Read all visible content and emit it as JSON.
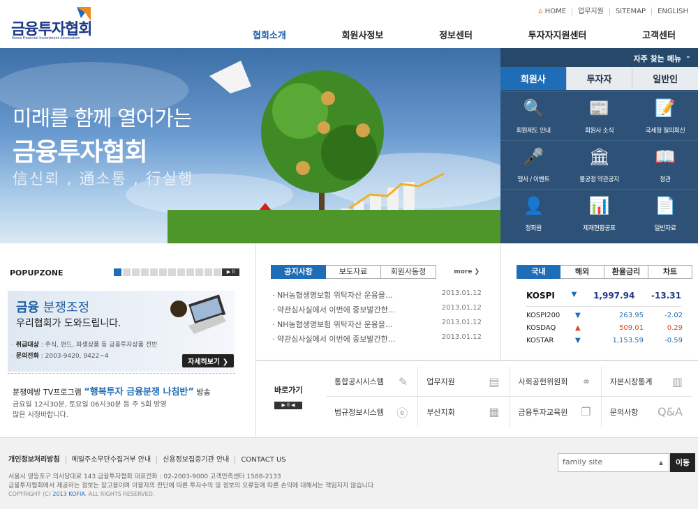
{
  "logo": {
    "title": "금융투자협회",
    "subtitle": "Korea Financial Investment Association"
  },
  "topnav": [
    "HOME",
    "업무지원",
    "SITEMAP",
    "ENGLISH"
  ],
  "gnb": [
    "협회소개",
    "회원사정보",
    "정보센터",
    "투자자지원센터",
    "고객센터"
  ],
  "hero": {
    "line1": "미래를 함께 열어가는",
    "line2": "금융투자협회",
    "line3": "信신뢰 , 通소통 , 行실행"
  },
  "quick": {
    "header": "자주 찾는 메뉴",
    "tabs": [
      "회원사",
      "투자자",
      "일반인"
    ],
    "items": [
      {
        "label": "회원제도 안내",
        "icon": "magnifier-icon"
      },
      {
        "label": "회원사 소식",
        "icon": "newspaper-icon"
      },
      {
        "label": "국세청 질의회신",
        "icon": "document-pencil-icon"
      },
      {
        "label": "행사 / 이벤트",
        "icon": "microphone-icon"
      },
      {
        "label": "불공정 약관공지",
        "icon": "building-icon"
      },
      {
        "label": "정관",
        "icon": "book-icon"
      },
      {
        "label": "정회원",
        "icon": "member-icon"
      },
      {
        "label": "제재현황공표",
        "icon": "chart-magnifier-icon"
      },
      {
        "label": "일반자료",
        "icon": "file-icon"
      }
    ]
  },
  "popup": {
    "title": "POPUPZONE",
    "control": "▶ ll",
    "banner": {
      "title_bold": "금융",
      "title_rest": " 분쟁조정",
      "line2": "우리협회가 도와드립니다.",
      "d1_label": "취급대상",
      "d1": " : 주식, 펀드, 파생상품 등 금융투자상품 전반",
      "d2_label": "문의전화",
      "d2": " : 2003-9420, 9422~4",
      "more": "자세히보기 ❯"
    },
    "tv1_a": "분쟁예방 TV프로그램 ",
    "tv1_b": "“행복투자 금융분쟁 나침반”",
    "tv1_c": " 방송",
    "tv2": "금요일 12시30분, 토요일 06시30분 등 주 5회 방영",
    "tv3": "많은 시청바랍니다."
  },
  "notice": {
    "tabs": [
      "공지사항",
      "보도자료",
      "회원사동정"
    ],
    "more": "more ❯",
    "items": [
      {
        "t": "· NH농협생명보험 위탁자산 운용을...",
        "d": "2013.01.12"
      },
      {
        "t": "· 약관심사실에서 이번에 중보발간한...",
        "d": "2013.01.12"
      },
      {
        "t": "· NH농협생명보험 위탁자산 운용을...",
        "d": "2013.01.12"
      },
      {
        "t": "· 약관심사실에서 이번에 중보발간한...",
        "d": "2013.01.12"
      }
    ]
  },
  "stock": {
    "tabs": [
      "국내",
      "해외",
      "환율금리",
      "차트"
    ],
    "main": {
      "name": "KOSPI",
      "value": "1,997.94",
      "change": "-13.31"
    },
    "sub": [
      {
        "name": "KOSPI200",
        "value": "263.95",
        "change": "-2.02",
        "dir": "down"
      },
      {
        "name": "KOSDAQ",
        "value": "509.01",
        "change": "0.29",
        "dir": "up"
      },
      {
        "name": "KOSTAR",
        "value": "1,153.59",
        "change": "-0.59",
        "dir": "down"
      }
    ]
  },
  "shortcuts": {
    "label": "바로가기",
    "control": "▶ ll ◀",
    "items": [
      "통합공시시스템",
      "업무지원",
      "사회공헌위원회",
      "자본시장통계",
      "법규정보시스템",
      "부산지회",
      "금융투자교육원",
      "문의사항"
    ]
  },
  "footer": {
    "links": [
      "개인정보처리방침",
      "메일주소무단수집거부 안내",
      "신용정보집중기관 안내",
      "CONTACT US"
    ],
    "addr1": "서울시 영등포구 의사당대로 143 금융투자협회  대표전화 : 02-2003-9000   고객만족센터 1588-2133",
    "addr2": "금융투자협회에서 제공하는 정보는 참고용이며 이용자의 판단에 따른 투자수익 및 정보의 오류등에 따른 손익에 대해서는 책임지지 않습니다",
    "copy_a": "COPYRIGHT (C) ",
    "copy_b": "2013 KOFIA",
    "copy_c": ". ALL RIGHTS RESERVED.",
    "family": "family site",
    "go": "이동"
  }
}
